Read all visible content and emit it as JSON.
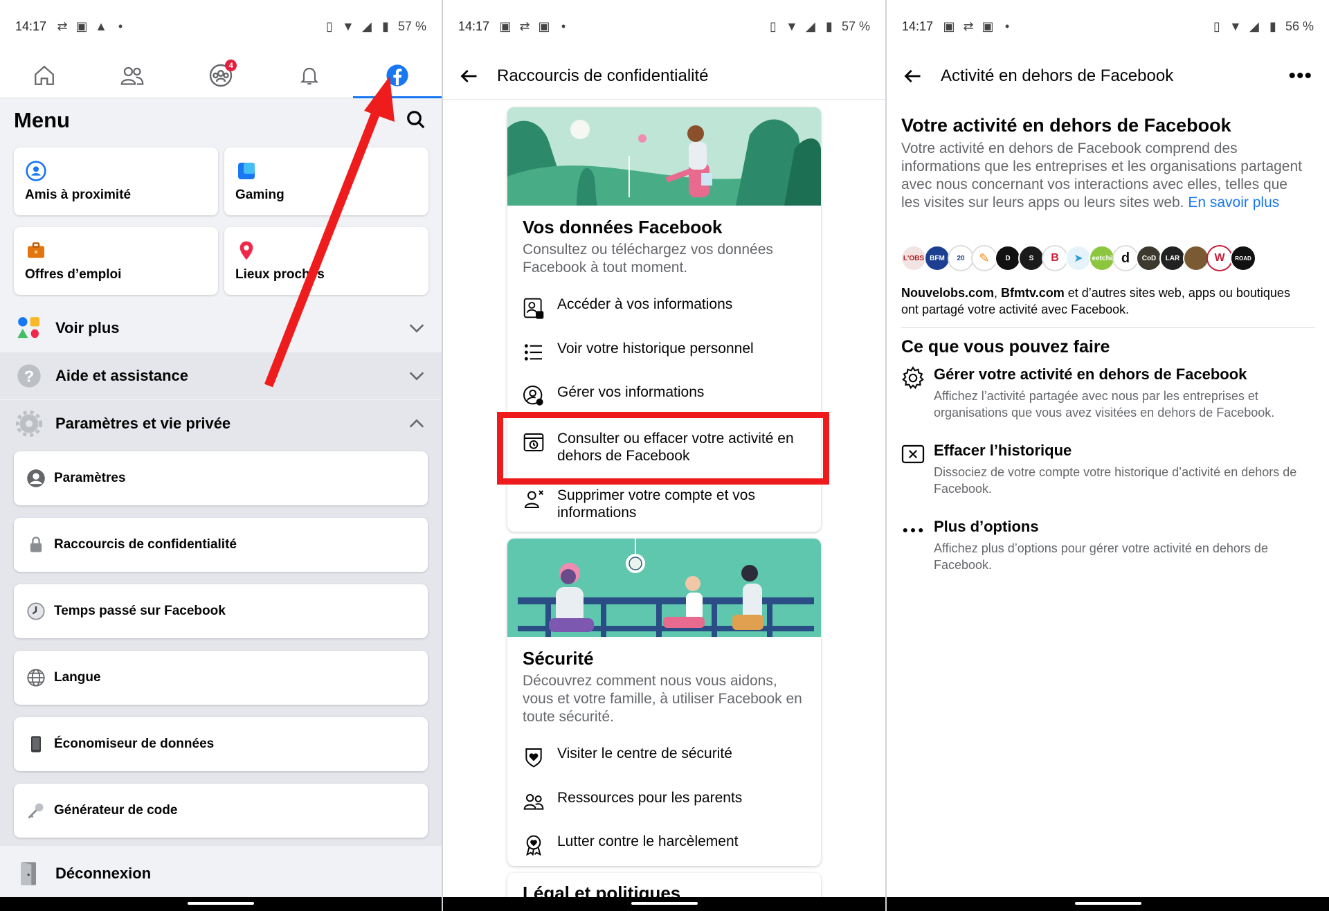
{
  "panel1": {
    "status": {
      "time": "14:17",
      "battery": "57 %"
    },
    "nav": {
      "notif_badge": "4"
    },
    "menu_title": "Menu",
    "tiles": [
      {
        "label": "Amis à proximité"
      },
      {
        "label": "Gaming"
      },
      {
        "label": "Offres d’emploi"
      },
      {
        "label": "Lieux proches"
      }
    ],
    "voir_plus": "Voir plus",
    "aide": "Aide et assistance",
    "parametres_section": "Paramètres et vie privée",
    "settings": [
      "Paramètres",
      "Raccourcis de confidentialité",
      "Temps passé sur Facebook",
      "Langue",
      "Économiseur de données",
      "Générateur de code"
    ],
    "deconnexion": "Déconnexion"
  },
  "panel2": {
    "status": {
      "time": "14:17",
      "battery": "57 %"
    },
    "title": "Raccourcis de confidentialité",
    "card1": {
      "title": "Vos données Facebook",
      "desc": "Consultez ou téléchargez vos données Facebook à tout moment.",
      "items": [
        "Accéder à vos informations",
        "Voir votre historique personnel",
        "Gérer vos informations",
        "Consulter ou effacer votre activité en dehors de Facebook",
        "Supprimer votre compte et vos informations"
      ]
    },
    "card2": {
      "title": "Sécurité",
      "desc": "Découvrez comment nous vous aidons, vous et votre famille, à utiliser Facebook en toute sécurité.",
      "items": [
        "Visiter le centre de sécurité",
        "Ressources pour les parents",
        "Lutter contre le harcèlement"
      ]
    },
    "card3_title": "Légal et politiques"
  },
  "panel3": {
    "status": {
      "time": "14:17",
      "battery": "56 %"
    },
    "title": "Activité en dehors de Facebook",
    "heading": "Votre activité en dehors de Facebook",
    "intro": "Votre activité en dehors de Facebook comprend des informations que les entreprises et les organisations partagent avec nous concernant vos interactions avec elles, telles que les visites sur leurs apps ou leurs sites web.",
    "learn_more": "En savoir plus",
    "logos": [
      "L'OBS",
      "BFM",
      "20",
      "carrot",
      "D",
      "S",
      "B",
      "bird",
      "eetchi",
      "d",
      "CoD",
      "LAR",
      "lion",
      "W",
      "ROAD"
    ],
    "sites_bold1": "Nouvelobs.com",
    "sites_sep": ", ",
    "sites_bold2": "Bfmtv.com",
    "sites_rest": " et d’autres sites web, apps ou boutiques ont partagé votre activité avec Facebook.",
    "section_title": "Ce que vous pouvez faire",
    "options": [
      {
        "icon": "gear-icon",
        "title": "Gérer votre activité en dehors de Facebook",
        "desc": "Affichez l’activité partagée avec nous par les entreprises et organisations que vous avez visitées en dehors de Facebook."
      },
      {
        "icon": "close-box-icon",
        "title": "Effacer l’historique",
        "desc": "Dissociez de votre compte votre historique d’activité en dehors de Facebook."
      },
      {
        "icon": "more-dots-icon",
        "title": "Plus d’options",
        "desc": "Affichez plus d’options pour gérer votre activité en dehors de Facebook."
      }
    ]
  },
  "colors": {
    "facebook_blue": "#1877f2",
    "highlight_red": "#ed1b1b",
    "arrow_red": "#ee1c1c",
    "teal": "#3cb599"
  }
}
